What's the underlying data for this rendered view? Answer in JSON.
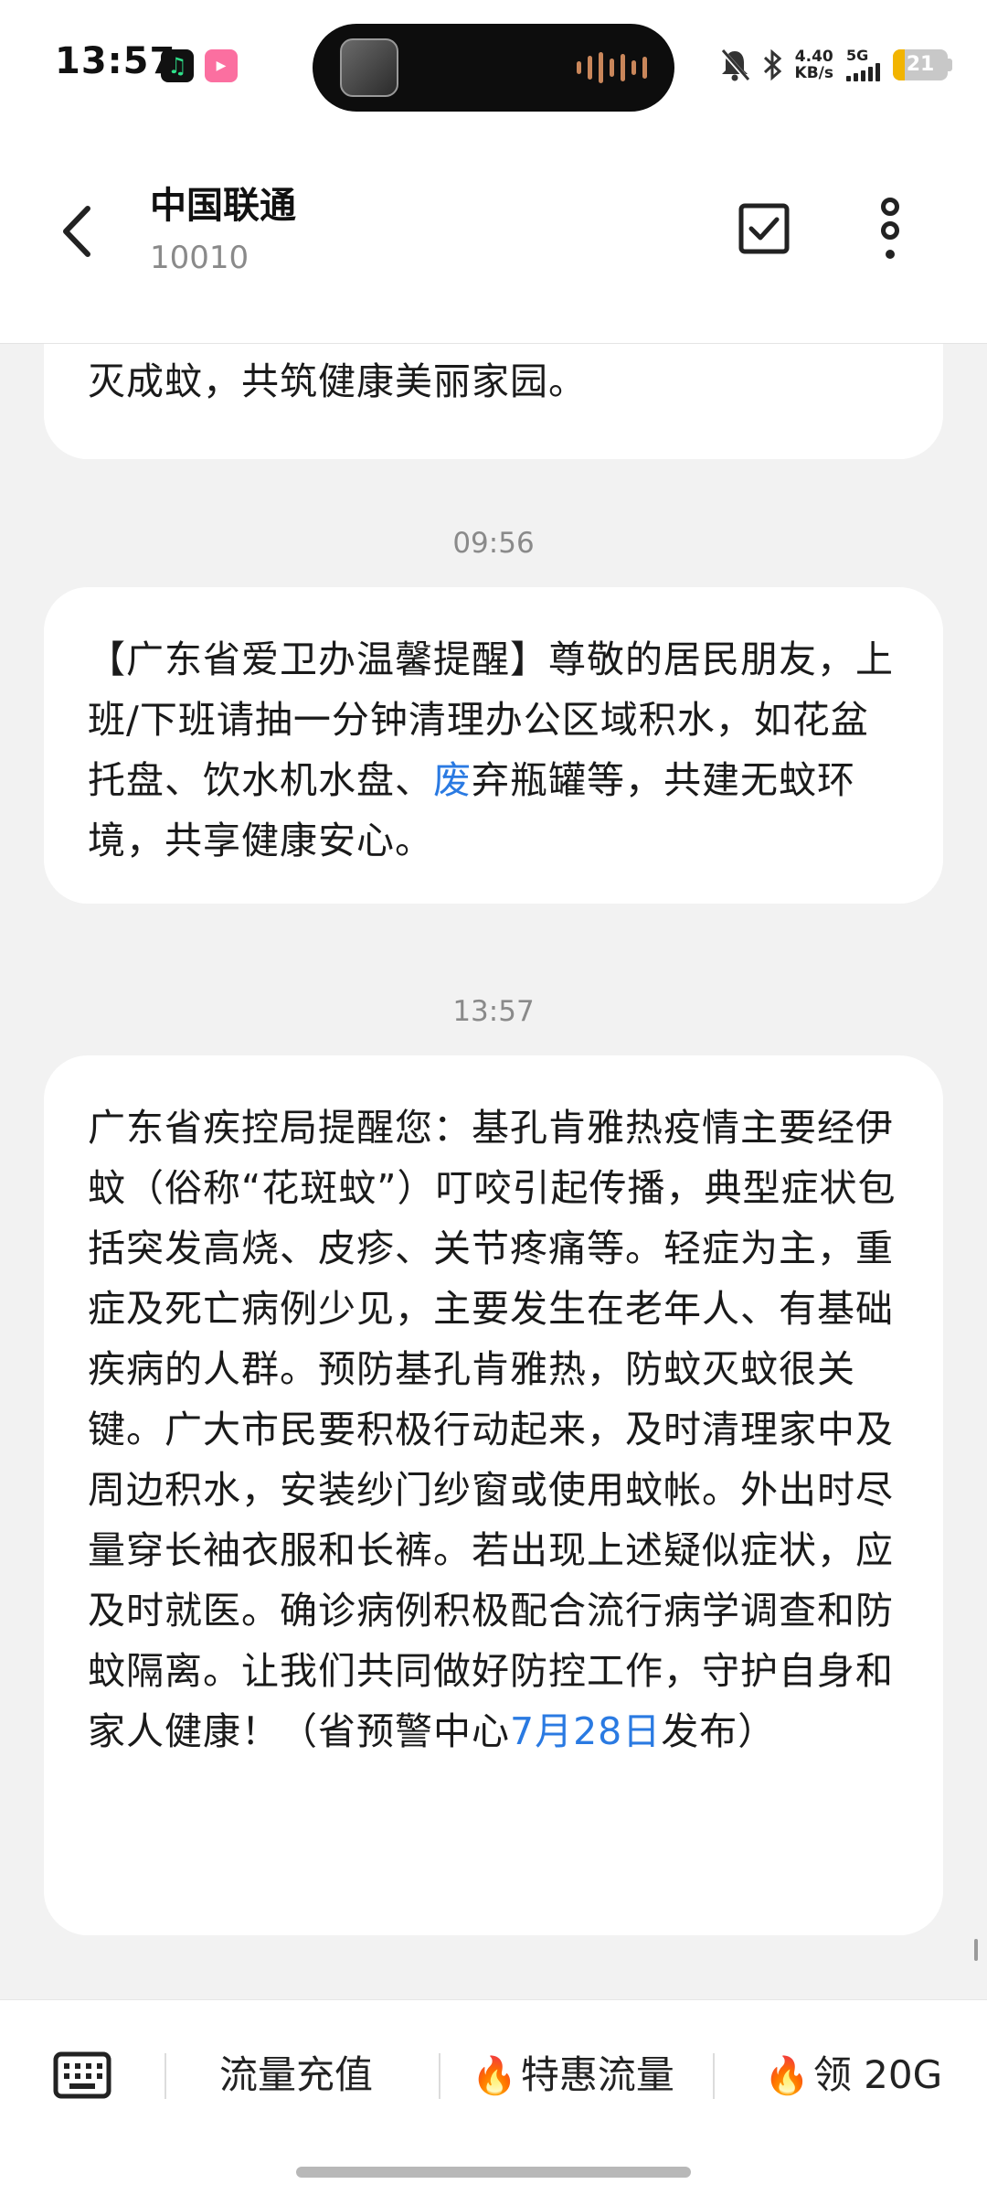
{
  "status_bar": {
    "time": "13:57",
    "net_speed_value": "4.40",
    "net_speed_unit": "KB/s",
    "network": "5G",
    "battery": "21",
    "battery_level": 0.21,
    "icons": [
      "app-music-icon",
      "bilibili-icon",
      "mute-icon",
      "bluetooth-icon",
      "signal-icon",
      "battery-icon"
    ]
  },
  "header": {
    "title": "中国联通",
    "subtitle": "10010"
  },
  "messages": [
    {
      "time": "",
      "text": "灭成蚊，共筑健康美丽家园。"
    },
    {
      "time": "09:56",
      "text_before_link": "【广东省爱卫办温馨提醒】尊敬的居民朋友，上班/下班请抽一分钟清理办公区域积水，如花盆托盘、饮水机水盘、",
      "link": "废",
      "text_after_link": "弃瓶罐等，共建无蚊环境，共享健康安心。"
    },
    {
      "time": "13:57",
      "text_before_link": "广东省疾控局提醒您：基孔肯雅热疫情主要经伊蚊（俗称“花斑蚊”）叮咬引起传播，典型症状包括突发高烧、皮疹、关节疼痛等。轻症为主，重症及死亡病例少见，主要发生在老年人、有基础疾病的人群。预防基孔肯雅热，防蚊灭蚊很关键。广大市民要积极行动起来，及时清理家中及周边积水，安装纱门纱窗或使用蚊帐。外出时尽量穿长袖衣服和长裤。若出现上述疑似症状，应及时就医。确诊病例积极配合流行病学调查和防蚊隔离。让我们共同做好防控工作，守护自身和家人健康！（省预警中心",
      "link": "7月28日",
      "text_after_link": "发布）"
    }
  ],
  "bottom_menu": {
    "items": [
      {
        "label": "流量充值"
      },
      {
        "label": "特惠流量"
      },
      {
        "label": "领 20G"
      }
    ]
  },
  "colors": {
    "link": "#2a7ae2",
    "background": "#f2f2f2",
    "bubble": "#ffffff"
  }
}
